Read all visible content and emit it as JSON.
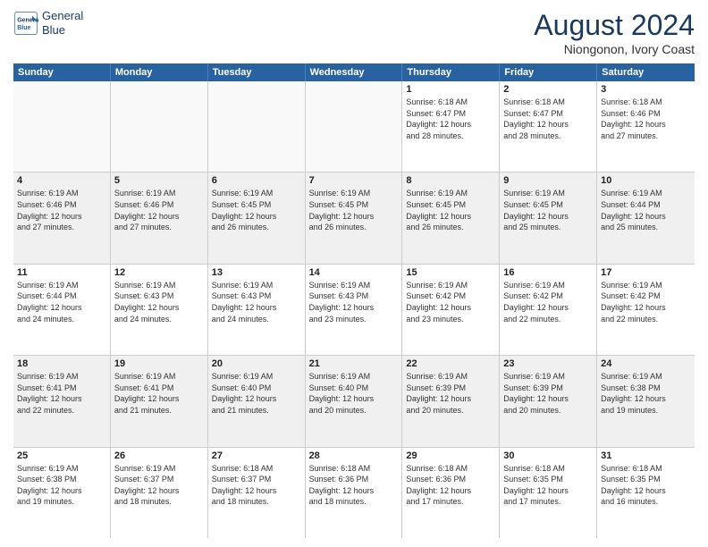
{
  "logo": {
    "line1": "General",
    "line2": "Blue"
  },
  "title": "August 2024",
  "location": "Niongonon, Ivory Coast",
  "days": [
    "Sunday",
    "Monday",
    "Tuesday",
    "Wednesday",
    "Thursday",
    "Friday",
    "Saturday"
  ],
  "weeks": [
    [
      {
        "day": "",
        "info": ""
      },
      {
        "day": "",
        "info": ""
      },
      {
        "day": "",
        "info": ""
      },
      {
        "day": "",
        "info": ""
      },
      {
        "day": "1",
        "info": "Sunrise: 6:18 AM\nSunset: 6:47 PM\nDaylight: 12 hours\nand 28 minutes."
      },
      {
        "day": "2",
        "info": "Sunrise: 6:18 AM\nSunset: 6:47 PM\nDaylight: 12 hours\nand 28 minutes."
      },
      {
        "day": "3",
        "info": "Sunrise: 6:18 AM\nSunset: 6:46 PM\nDaylight: 12 hours\nand 27 minutes."
      }
    ],
    [
      {
        "day": "4",
        "info": "Sunrise: 6:19 AM\nSunset: 6:46 PM\nDaylight: 12 hours\nand 27 minutes."
      },
      {
        "day": "5",
        "info": "Sunrise: 6:19 AM\nSunset: 6:46 PM\nDaylight: 12 hours\nand 27 minutes."
      },
      {
        "day": "6",
        "info": "Sunrise: 6:19 AM\nSunset: 6:45 PM\nDaylight: 12 hours\nand 26 minutes."
      },
      {
        "day": "7",
        "info": "Sunrise: 6:19 AM\nSunset: 6:45 PM\nDaylight: 12 hours\nand 26 minutes."
      },
      {
        "day": "8",
        "info": "Sunrise: 6:19 AM\nSunset: 6:45 PM\nDaylight: 12 hours\nand 26 minutes."
      },
      {
        "day": "9",
        "info": "Sunrise: 6:19 AM\nSunset: 6:45 PM\nDaylight: 12 hours\nand 25 minutes."
      },
      {
        "day": "10",
        "info": "Sunrise: 6:19 AM\nSunset: 6:44 PM\nDaylight: 12 hours\nand 25 minutes."
      }
    ],
    [
      {
        "day": "11",
        "info": "Sunrise: 6:19 AM\nSunset: 6:44 PM\nDaylight: 12 hours\nand 24 minutes."
      },
      {
        "day": "12",
        "info": "Sunrise: 6:19 AM\nSunset: 6:43 PM\nDaylight: 12 hours\nand 24 minutes."
      },
      {
        "day": "13",
        "info": "Sunrise: 6:19 AM\nSunset: 6:43 PM\nDaylight: 12 hours\nand 24 minutes."
      },
      {
        "day": "14",
        "info": "Sunrise: 6:19 AM\nSunset: 6:43 PM\nDaylight: 12 hours\nand 23 minutes."
      },
      {
        "day": "15",
        "info": "Sunrise: 6:19 AM\nSunset: 6:42 PM\nDaylight: 12 hours\nand 23 minutes."
      },
      {
        "day": "16",
        "info": "Sunrise: 6:19 AM\nSunset: 6:42 PM\nDaylight: 12 hours\nand 22 minutes."
      },
      {
        "day": "17",
        "info": "Sunrise: 6:19 AM\nSunset: 6:42 PM\nDaylight: 12 hours\nand 22 minutes."
      }
    ],
    [
      {
        "day": "18",
        "info": "Sunrise: 6:19 AM\nSunset: 6:41 PM\nDaylight: 12 hours\nand 22 minutes."
      },
      {
        "day": "19",
        "info": "Sunrise: 6:19 AM\nSunset: 6:41 PM\nDaylight: 12 hours\nand 21 minutes."
      },
      {
        "day": "20",
        "info": "Sunrise: 6:19 AM\nSunset: 6:40 PM\nDaylight: 12 hours\nand 21 minutes."
      },
      {
        "day": "21",
        "info": "Sunrise: 6:19 AM\nSunset: 6:40 PM\nDaylight: 12 hours\nand 20 minutes."
      },
      {
        "day": "22",
        "info": "Sunrise: 6:19 AM\nSunset: 6:39 PM\nDaylight: 12 hours\nand 20 minutes."
      },
      {
        "day": "23",
        "info": "Sunrise: 6:19 AM\nSunset: 6:39 PM\nDaylight: 12 hours\nand 20 minutes."
      },
      {
        "day": "24",
        "info": "Sunrise: 6:19 AM\nSunset: 6:38 PM\nDaylight: 12 hours\nand 19 minutes."
      }
    ],
    [
      {
        "day": "25",
        "info": "Sunrise: 6:19 AM\nSunset: 6:38 PM\nDaylight: 12 hours\nand 19 minutes."
      },
      {
        "day": "26",
        "info": "Sunrise: 6:19 AM\nSunset: 6:37 PM\nDaylight: 12 hours\nand 18 minutes."
      },
      {
        "day": "27",
        "info": "Sunrise: 6:18 AM\nSunset: 6:37 PM\nDaylight: 12 hours\nand 18 minutes."
      },
      {
        "day": "28",
        "info": "Sunrise: 6:18 AM\nSunset: 6:36 PM\nDaylight: 12 hours\nand 18 minutes."
      },
      {
        "day": "29",
        "info": "Sunrise: 6:18 AM\nSunset: 6:36 PM\nDaylight: 12 hours\nand 17 minutes."
      },
      {
        "day": "30",
        "info": "Sunrise: 6:18 AM\nSunset: 6:35 PM\nDaylight: 12 hours\nand 17 minutes."
      },
      {
        "day": "31",
        "info": "Sunrise: 6:18 AM\nSunset: 6:35 PM\nDaylight: 12 hours\nand 16 minutes."
      }
    ]
  ]
}
